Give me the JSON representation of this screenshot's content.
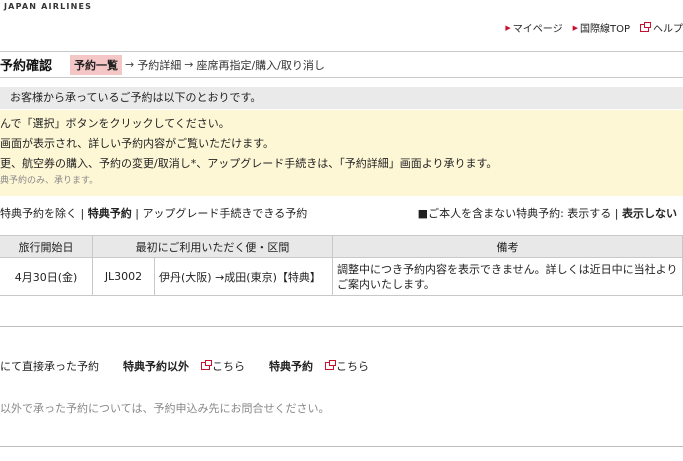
{
  "brand": {
    "name": "JAPAN AIRLINES"
  },
  "topnav": {
    "items": [
      {
        "label": "マイページ",
        "icon": "triangle-right-icon"
      },
      {
        "label": "国際線TOP",
        "icon": "triangle-right-icon"
      },
      {
        "label": "ヘルプ",
        "icon": "external-window-icon"
      }
    ]
  },
  "header": {
    "title": "予約確認",
    "steps": [
      "予約一覧",
      "予約詳細",
      "座席再指定/購入/取り消し"
    ],
    "arrow": "→"
  },
  "greeting": "お客様から承っているご予約は以下のとおりです。",
  "notes": [
    "んで「選択」ボタンをクリックしてください。",
    "画面が表示され、詳しい予約内容がご覧いただけます。",
    "更、航空券の購入、予約の変更/取消し*、アップグレード手続きは、「予約詳細」画面より承ります。"
  ],
  "notes_small": "典予約のみ、承ります。",
  "filters": {
    "left": [
      "特典予約を除く",
      "特典予約",
      "アップグレード手続きできる予約"
    ],
    "separator": "|",
    "right_prefix": "■ご本人を含まない特典予約:",
    "right_options": [
      "表示する",
      "表示しない"
    ]
  },
  "table": {
    "headers": [
      "旅行開始日",
      "最初にご利用いただく便・区間",
      "備考"
    ],
    "rows": [
      {
        "date": "4月30日(金)",
        "flight": "JL3002",
        "route": "伊丹(大阪) →成田(東京)【特典】",
        "note": "調整中につき予約内容を表示できません。詳しくは近日中に当社よりご案内いたします。"
      }
    ]
  },
  "direct": {
    "label": "にて直接承った予約",
    "items": [
      {
        "label": "特典予約以外",
        "link": "こちら"
      },
      {
        "label": "特典予約",
        "link": "こちら"
      }
    ]
  },
  "other": "以外で承った予約については、予約申込み先にお問合せください。",
  "colors": {
    "accent": "#c8102e",
    "current_step": "#f4c6c6",
    "notes_bg": "#fdf7d6",
    "greeting_bg": "#eaeaea"
  }
}
